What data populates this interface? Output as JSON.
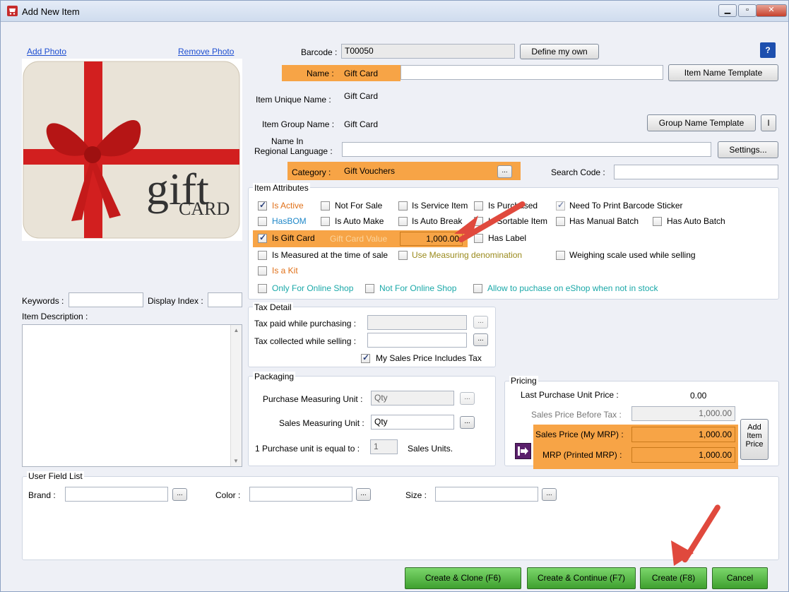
{
  "window": {
    "title": "Add New Item",
    "controls": [
      "minimize",
      "maximize",
      "close"
    ]
  },
  "photo": {
    "add_label": "Add Photo",
    "remove_label": "Remove Photo",
    "card_word": "gift",
    "card_sub": "CARD"
  },
  "form": {
    "barcode_label": "Barcode :",
    "barcode_value": "T00050",
    "define_own_label": "Define my own",
    "help_label": "?",
    "name_label": "Name :",
    "name_value": "Gift Card",
    "item_name_template_label": "Item Name Template",
    "unique_name_label": "Item Unique Name :",
    "unique_name_value": "Gift Card",
    "group_name_label": "Item Group Name :",
    "group_name_value": "Gift Card",
    "group_name_template_label": "Group Name Template",
    "group_btn_small_label": "I",
    "regional_label_1": "Name In",
    "regional_label_2": "Regional Language :",
    "settings_label": "Settings...",
    "category_label": "Category :",
    "category_value": "Gift Vouchers",
    "search_code_label": "Search Code :"
  },
  "attributes": {
    "title": "Item Attributes",
    "is_active": "Is Active",
    "not_for_sale": "Not For Sale",
    "is_service_item": "Is Service Item",
    "is_purchased": "Is Purchased",
    "need_print_barcode": "Need To Print Barcode Sticker",
    "has_bom": "HasBOM",
    "is_auto_make": "Is Auto Make",
    "is_auto_break": "Is Auto Break",
    "is_sortable_item": "Is Sortable Item",
    "has_manual_batch": "Has Manual Batch",
    "has_auto_batch": "Has Auto Batch",
    "is_gift_card": "Is Gift Card",
    "gift_card_value_label": "Gift Card Value",
    "gift_card_value": "1,000.00",
    "has_label": "Has Label",
    "is_measured": "Is Measured at the time of sale",
    "use_measuring_denom": "Use Measuring denomination",
    "weighing_scale": "Weighing scale used while selling",
    "is_a_kit": "Is a Kit",
    "only_online": "Only For Online Shop",
    "not_online": "Not For Online Shop",
    "allow_purchase_eshop": "Allow to puchase on eShop when not in stock"
  },
  "left_fields": {
    "keywords_label": "Keywords :",
    "display_index_label": "Display Index :",
    "item_description_label": "Item Description :"
  },
  "tax": {
    "title": "Tax Detail",
    "paid_label": "Tax paid while purchasing :",
    "collected_label": "Tax collected while selling :",
    "includes_tax_label": "My Sales Price Includes Tax"
  },
  "packaging": {
    "title": "Packaging",
    "purchase_unit_label": "Purchase Measuring Unit :",
    "purchase_unit_value": "Qty",
    "sales_unit_label": "Sales Measuring Unit :",
    "sales_unit_value": "Qty",
    "ratio_prefix": "1  Purchase unit is equal to :",
    "ratio_value": "1",
    "ratio_suffix": "Sales Units."
  },
  "pricing": {
    "title": "Pricing",
    "last_purchase_label": "Last Purchase  Unit Price :",
    "last_purchase_value": "0.00",
    "sales_before_tax_label": "Sales Price Before Tax :",
    "sales_before_tax_value": "1,000.00",
    "sales_price_label": "Sales Price (My MRP) :",
    "sales_price_value": "1,000.00",
    "mrp_label": "MRP (Printed MRP) :",
    "mrp_value": "1,000.00",
    "add_item_price_label_1": "Add",
    "add_item_price_label_2": "Item",
    "add_item_price_label_3": "Price"
  },
  "user_fields": {
    "title": "User Field List",
    "brand_label": "Brand :",
    "color_label": "Color :",
    "size_label": "Size :"
  },
  "footer": {
    "create_clone": "Create & Clone  (F6)",
    "create_continue": "Create & Continue (F7)",
    "create": "Create (F8)",
    "cancel": "Cancel"
  },
  "colors": {
    "highlight": "#f7a446",
    "accent_green": "#4db03a",
    "arrow": "#e0493d"
  },
  "dots_label": "..."
}
